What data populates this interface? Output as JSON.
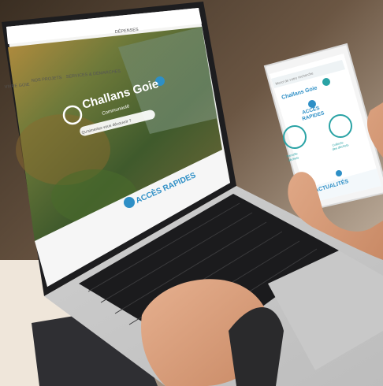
{
  "laptop_site": {
    "nav_items": [
      "VIVRE GOIE",
      "NOS PROJETS",
      "SERVICES & DÉMARCHES",
      "DÉPENSES"
    ],
    "logo_name": "Challans Goie",
    "logo_tagline": "Communauté",
    "hero_caption": "Qu'aimeriez-vous découvrir ?",
    "quick_access_label": "ACCÈS RAPIDES"
  },
  "phone_app": {
    "search_placeholder": "Merci de votre recherche",
    "logo_name": "Challans Goie",
    "quick_access_line1": "ACCÈS",
    "quick_access_line2": "RAPIDES",
    "tiles": [
      {
        "label_line1": "Parcelle",
        "label_line2": "déchets",
        "icon": "house-icon"
      },
      {
        "label_line1": "Collecte",
        "label_line2": "des déchets",
        "icon": "recycle-icon"
      }
    ],
    "news_label": "ACTUALITÉS"
  },
  "colors": {
    "accent_blue": "#2e8fc6",
    "teal": "#2aa3a5",
    "forest": "#4b6a2f"
  }
}
